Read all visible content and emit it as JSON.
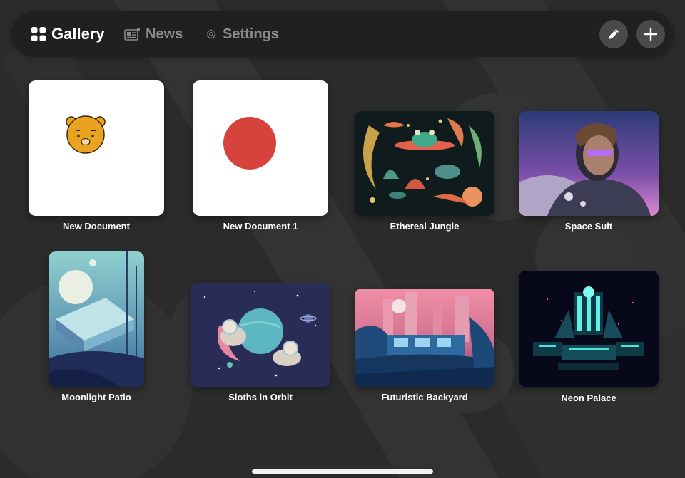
{
  "nav": {
    "tabs": [
      {
        "label": "Gallery",
        "icon": "grid-icon",
        "active": true
      },
      {
        "label": "News",
        "icon": "newspaper-icon",
        "active": false
      },
      {
        "label": "Settings",
        "icon": "gear-icon",
        "active": false
      }
    ],
    "actions": [
      {
        "icon": "pencil-icon"
      },
      {
        "icon": "plus-icon"
      }
    ]
  },
  "gallery": {
    "items": [
      {
        "title": "New Document"
      },
      {
        "title": "New Document 1"
      },
      {
        "title": "Ethereal Jungle"
      },
      {
        "title": "Space Suit"
      },
      {
        "title": "Moonlight Patio"
      },
      {
        "title": "Sloths in Orbit"
      },
      {
        "title": "Futuristic Backyard"
      },
      {
        "title": "Neon Palace"
      }
    ]
  },
  "colors": {
    "background": "#2b2b2b",
    "topbar": "#202020",
    "accent_red": "#d6433d",
    "muted_text": "#8a8a8a"
  }
}
